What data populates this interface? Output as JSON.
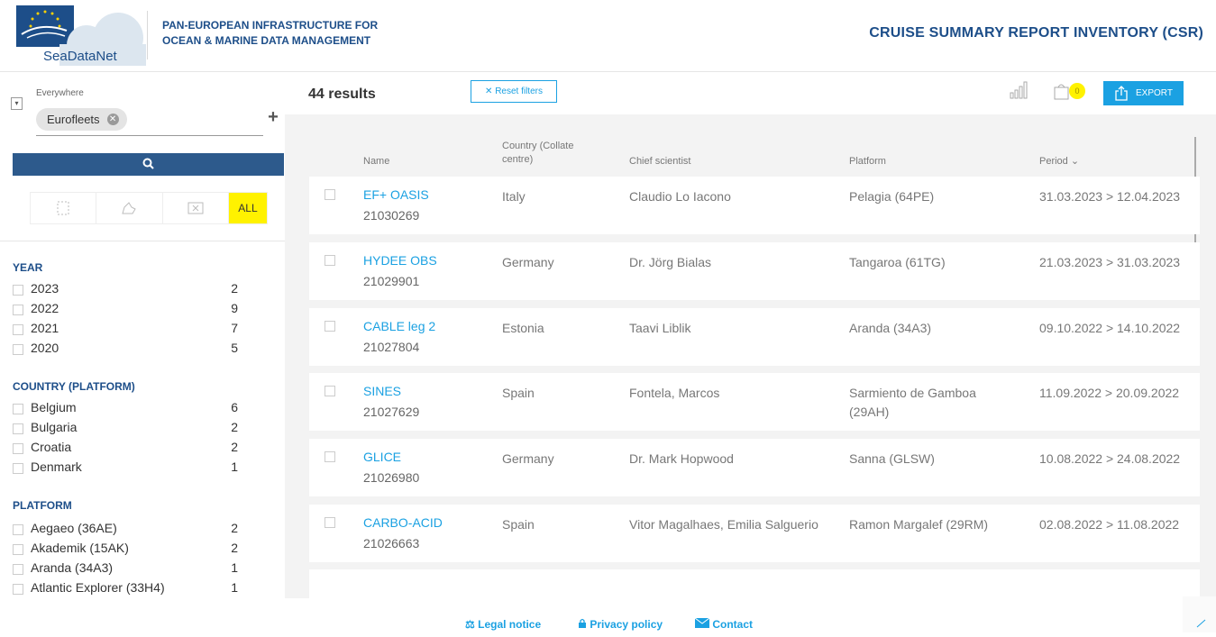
{
  "header": {
    "logo_text": "SeaDataNet",
    "tagline_line1": "PAN-EUROPEAN INFRASTRUCTURE FOR",
    "tagline_line2": "OCEAN & MARINE DATA MANAGEMENT",
    "app_title": "CRUISE SUMMARY REPORT INVENTORY (CSR)"
  },
  "search": {
    "scope_label": "Everywhere",
    "chip_label": "Eurofleets",
    "add_label": "+"
  },
  "geo_tools": {
    "all_label": "ALL"
  },
  "facets": {
    "year": {
      "title": "YEAR",
      "items": [
        {
          "label": "2023",
          "count": "2"
        },
        {
          "label": "2022",
          "count": "9"
        },
        {
          "label": "2021",
          "count": "7"
        },
        {
          "label": "2020",
          "count": "5"
        }
      ]
    },
    "country": {
      "title": "COUNTRY (PLATFORM)",
      "items": [
        {
          "label": "Belgium",
          "count": "6"
        },
        {
          "label": "Bulgaria",
          "count": "2"
        },
        {
          "label": "Croatia",
          "count": "2"
        },
        {
          "label": "Denmark",
          "count": "1"
        }
      ]
    },
    "platform": {
      "title": "PLATFORM",
      "items": [
        {
          "label": "Aegaeo (36AE)",
          "count": "2"
        },
        {
          "label": "Akademik (15AK)",
          "count": "2"
        },
        {
          "label": "Aranda (34A3)",
          "count": "1"
        },
        {
          "label": "Atlantic Explorer (33H4)",
          "count": "1"
        }
      ]
    }
  },
  "results": {
    "count_label": "44 results",
    "reset_label": "Reset filters",
    "basket_count": "0",
    "export_label": "EXPORT"
  },
  "table": {
    "headers": {
      "name": "Name",
      "country_line1": "Country (Collate",
      "country_line2": "centre)",
      "chief": "Chief scientist",
      "platform": "Platform",
      "period": "Period"
    },
    "rows": [
      {
        "name": "EF+ OASIS",
        "id": "21030269",
        "country": "Italy",
        "chief": "Claudio Lo Iacono",
        "platform": "Pelagia (64PE)",
        "platform2": "",
        "period": "31.03.2023 > 12.04.2023"
      },
      {
        "name": "HYDEE OBS",
        "id": "21029901",
        "country": "Germany",
        "chief": "Dr. Jörg Bialas",
        "platform": "Tangaroa (61TG)",
        "platform2": "",
        "period": "21.03.2023 > 31.03.2023"
      },
      {
        "name": "CABLE leg 2",
        "id": "21027804",
        "country": "Estonia",
        "chief": "Taavi Liblik",
        "platform": "Aranda (34A3)",
        "platform2": "",
        "period": "09.10.2022 > 14.10.2022"
      },
      {
        "name": "SINES",
        "id": "21027629",
        "country": "Spain",
        "chief": "Fontela, Marcos",
        "platform": "Sarmiento de Gamboa",
        "platform2": "(29AH)",
        "period": "11.09.2022 > 20.09.2022"
      },
      {
        "name": "GLICE",
        "id": "21026980",
        "country": "Germany",
        "chief": "Dr. Mark Hopwood",
        "platform": "Sanna (GLSW)",
        "platform2": "",
        "period": "10.08.2022 > 24.08.2022"
      },
      {
        "name": "CARBO-ACID",
        "id": "21026663",
        "country": "Spain",
        "chief": "Vitor Magalhaes, Emilia Salguerio",
        "platform": "Ramon Margalef (29RM)",
        "platform2": "",
        "period": "02.08.2022 > 11.08.2022"
      }
    ]
  },
  "footer": {
    "legal": "Legal notice",
    "privacy": "Privacy policy",
    "contact": "Contact"
  }
}
